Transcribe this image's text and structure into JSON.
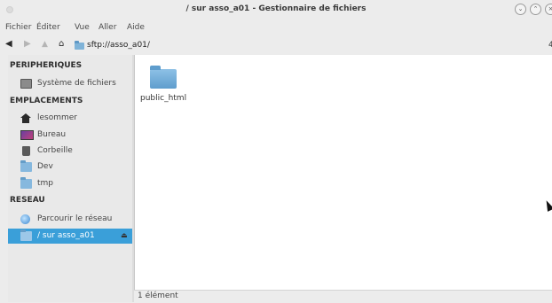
{
  "window": {
    "title": "/ sur asso_a01 - Gestionnaire de fichiers",
    "minimize_glyph": "⌄",
    "maximize_glyph": "⌃",
    "close_glyph": "×"
  },
  "menu": {
    "items": [
      "Fichier",
      "Éditer",
      "Vue",
      "Aller",
      "Aide"
    ]
  },
  "location": {
    "path": "sftp://asso_a01/",
    "edge_glyph": "4"
  },
  "sidebar": {
    "sections": [
      {
        "header": "PERIPHERIQUES",
        "items": [
          {
            "label": "Système de fichiers",
            "icon": "drive-icon"
          }
        ]
      },
      {
        "header": "EMPLACEMENTS",
        "items": [
          {
            "label": "lesommer",
            "icon": "home-icon"
          },
          {
            "label": "Bureau",
            "icon": "desktop-icon"
          },
          {
            "label": "Corbeille",
            "icon": "trash-icon"
          },
          {
            "label": "Dev",
            "icon": "folder-icon"
          },
          {
            "label": "tmp",
            "icon": "folder-icon"
          }
        ]
      },
      {
        "header": "RESEAU",
        "items": [
          {
            "label": "Parcourir le réseau",
            "icon": "network-globe-icon"
          },
          {
            "label": "/ sur asso_a01",
            "icon": "remote-folder-icon",
            "selected": true,
            "eject": "⏏"
          }
        ]
      }
    ]
  },
  "main": {
    "files": [
      {
        "name": "public_html",
        "icon": "folder-icon"
      }
    ]
  },
  "status": {
    "text": "1 élément"
  },
  "colors": {
    "selection": "#3a9fd9",
    "folder": "#86b8de"
  }
}
